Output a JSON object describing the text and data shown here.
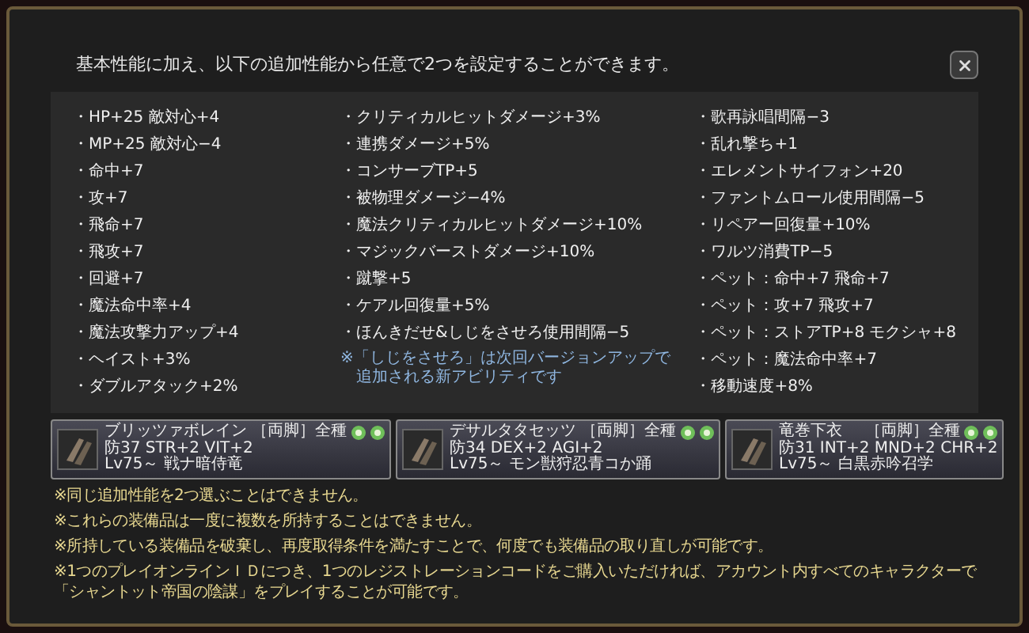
{
  "intro": "基本性能に加え、以下の追加性能から任意で2つを設定することができます。",
  "columns": [
    {
      "items": [
        "・HP+25 敵対心+4",
        "・MP+25 敵対心−4",
        "・命中+7",
        "・攻+7",
        "・飛命+7",
        "・飛攻+7",
        "・回避+7",
        "・魔法命中率+4",
        "・魔法攻撃力アップ+4",
        "・ヘイスト+3%",
        "・ダブルアタック+2%"
      ]
    },
    {
      "items": [
        "・クリティカルヒットダメージ+3%",
        "・連携ダメージ+5%",
        "・コンサーブTP+5",
        "・被物理ダメージ−4%",
        "・魔法クリティカルヒットダメージ+10%",
        "・マジックバーストダメージ+10%",
        "・蹴撃+5",
        "・ケアル回復量+5%",
        "・ほんきだせ&しじをさせろ使用間隔−5"
      ],
      "note": [
        "※「しじをさせろ」は次回バージョンアップで",
        "追加される新アビリティです"
      ]
    },
    {
      "items": [
        "・歌再詠唱間隔−3",
        "・乱れ撃ち+1",
        "・エレメントサイフォン+20",
        "・ファントムロール使用間隔−5",
        "・リペアー回復量+10%",
        "・ワルツ消費TP−5",
        "・ペット：命中+7 飛命+7",
        "・ペット：攻+7 飛攻+7",
        "・ペット：ストアTP+8 モクシャ+8",
        "・ペット：魔法命中率+7",
        "・移動速度+8%"
      ]
    }
  ],
  "equipment": [
    {
      "name": "ブリッツァボレイン",
      "slot": "［両脚］全種",
      "stats": "防37 STR+2 VIT+2",
      "level": "Lv75～ 戦ナ暗侍竜"
    },
    {
      "name": "デサルタタセッツ",
      "slot": "［両脚］全種",
      "stats": "防34 DEX+2 AGI+2",
      "level": "Lv75～ モン獣狩忍青コか踊"
    },
    {
      "name": "竜巻下衣",
      "slot": "［両脚］全種",
      "stats": "防31 INT+2 MND+2 CHR+2",
      "level": "Lv75～ 白黒赤吟召学"
    }
  ],
  "notes": [
    "※同じ追加性能を2つ選ぶことはできません。",
    "※これらの装備品は一度に複数を所持することはできません。",
    "※所持している装備品を破棄し、再度取得条件を満たすことで、何度でも装備品の取り直しが可能です。",
    [
      "※1つのプレイオンラインＩＤにつき、1つのレジストレーションコードをご購入いただければ、アカウント内すべてのキャラクターで",
      "「シャントット帝国の陰謀」をプレイすることが可能です。"
    ]
  ]
}
